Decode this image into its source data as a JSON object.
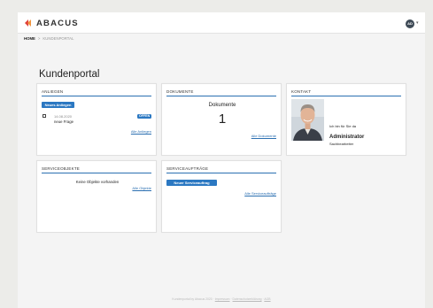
{
  "app": {
    "logo_text": "ABACUS",
    "avatar_initials": "AD"
  },
  "breadcrumb": {
    "home": "HOME",
    "separator": ">",
    "current": "KUNDENPORTAL"
  },
  "page": {
    "title": "Kundenportal"
  },
  "cards": {
    "anliegen": {
      "title": "ANLIEGEN",
      "button": "Neues Anliegen",
      "item": {
        "date": "14.08.2020",
        "subject": "neue Frage",
        "status": "OFFEN"
      },
      "link": "Alle Anliegen"
    },
    "dokumente": {
      "title": "DOKUMENTE",
      "label": "Dokumente",
      "count": "1",
      "link": "Alle Dokumente"
    },
    "kontakt": {
      "title": "KONTAKT",
      "intro": "Ich bin für Sie da",
      "name": "Administrator",
      "role": "Sachbearbeiter"
    },
    "serviceobjekte": {
      "title": "SERVICEOBJEKTE",
      "empty": "Keine Objekte vorhanden",
      "link": "Alle Objekte"
    },
    "serviceauftraege": {
      "title": "SERVICEAUFTRÄGE",
      "button": "Neuer Serviceauftrag",
      "link": "Alle Serviceaufträge"
    }
  },
  "footer": {
    "copyright": "Kundenportal by Abacus 2020",
    "sep": "·",
    "link1": "Impressum",
    "link2": "Datenschutzerklärung",
    "link3": "AGB"
  },
  "colors": {
    "accent": "#2b78c2",
    "rule": "#2b6fb1",
    "background": "#ecece9"
  }
}
